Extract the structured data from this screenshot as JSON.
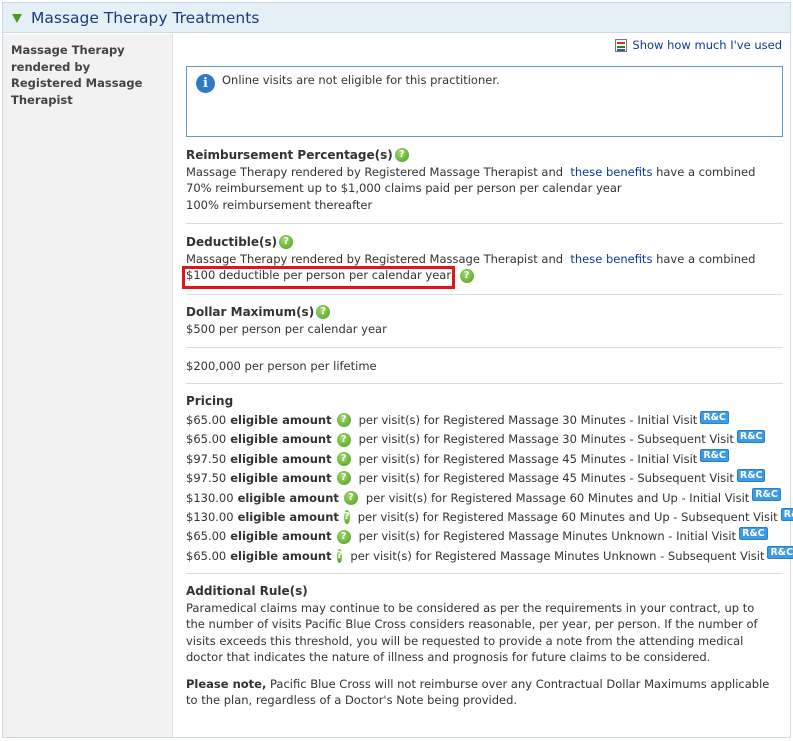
{
  "panel": {
    "title": "Massage Therapy Treatments"
  },
  "left": {
    "label": "Massage Therapy rendered by Registered Massage Therapist"
  },
  "usage_link": {
    "label": "Show how much I've used"
  },
  "info": {
    "text": "Online visits are not eligible for this practitioner."
  },
  "reimbursement": {
    "title": "Reimbursement Percentage(s)",
    "intro": "Massage Therapy rendered by Registered Massage Therapist and",
    "link": "these benefits",
    "suffix": "have a combined",
    "line1": "70% reimbursement up to $1,000 claims paid per person per calendar year",
    "line2": "100% reimbursement thereafter"
  },
  "deductible": {
    "title": "Deductible(s)",
    "intro": "Massage Therapy rendered by Registered Massage Therapist and",
    "link": "these benefits",
    "suffix": "have a combined",
    "line1": "$100 deductible per person per calendar year"
  },
  "dollar_max": {
    "title": "Dollar Maximum(s)",
    "line1": "$500 per person per calendar year",
    "line2": "$200,000 per person per lifetime"
  },
  "pricing": {
    "title": "Pricing",
    "eligible_label": "eligible amount",
    "badge": "R&C",
    "rows": [
      {
        "price": "$65.00",
        "desc": "per visit(s) for Registered Massage 30 Minutes - Initial Visit"
      },
      {
        "price": "$65.00",
        "desc": "per visit(s) for Registered Massage 30 Minutes - Subsequent Visit"
      },
      {
        "price": "$97.50",
        "desc": "per visit(s) for Registered Massage 45 Minutes - Initial Visit"
      },
      {
        "price": "$97.50",
        "desc": "per visit(s) for Registered Massage 45 Minutes - Subsequent Visit"
      },
      {
        "price": "$130.00",
        "desc": "per visit(s) for Registered Massage 60 Minutes and Up - Initial Visit"
      },
      {
        "price": "$130.00",
        "desc": "per visit(s) for Registered Massage 60 Minutes and Up - Subsequent Visit"
      },
      {
        "price": "$65.00",
        "desc": "per visit(s) for Registered Massage Minutes Unknown - Initial Visit"
      },
      {
        "price": "$65.00",
        "desc": "per visit(s) for Registered Massage Minutes Unknown - Subsequent Visit"
      }
    ]
  },
  "additional": {
    "title": "Additional Rule(s)",
    "text": "Paramedical claims may continue to be considered as per the requirements in your contract, up to the number of visits Pacific Blue Cross considers reasonable, per year, per person.  If the number of visits exceeds this threshold, you will be requested to provide a note from the attending medical doctor that indicates the nature of illness and prognosis for future claims to be considered.",
    "note_bold": "Please note,",
    "note_text": "Pacific Blue Cross will not reimburse over any Contractual Dollar Maximums applicable to the plan, regardless of a Doctor's Note being provided."
  },
  "colors": {
    "header_bg": "#e5f0f6",
    "title": "#1a3d7a",
    "link": "#0b3a9c",
    "highlight": "#e0161b",
    "help_icon": "#4e9e1f",
    "badge": "#3d9be6"
  },
  "icons": {
    "expand": "triangle-down-icon",
    "help": "question-circle-icon",
    "info": "info-circle-icon",
    "usage": "usage-report-icon"
  }
}
